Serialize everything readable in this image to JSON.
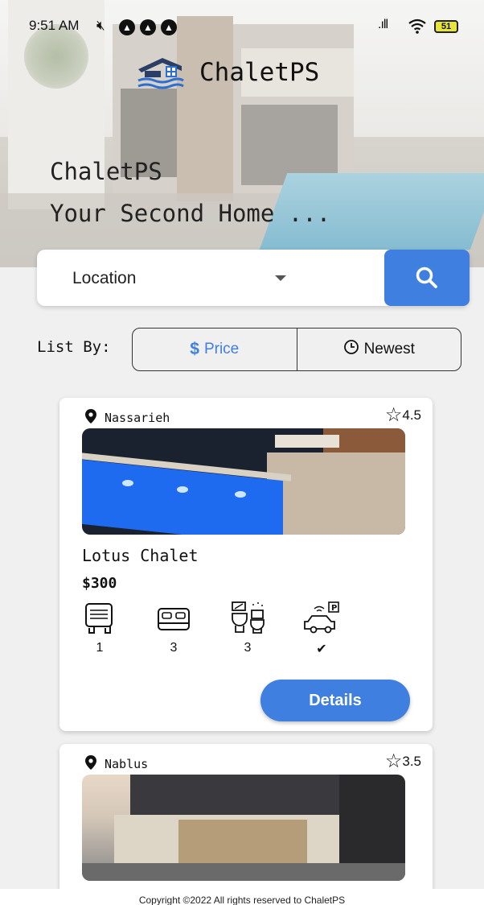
{
  "status_bar": {
    "time": "9:51 AM",
    "battery": "51"
  },
  "header": {
    "app_name": "ChaletPS",
    "tagline_line1": "ChaletPS",
    "tagline_line2": "Your Second Home ..."
  },
  "search": {
    "location_value": "Location"
  },
  "sort": {
    "label": "List By:",
    "options": [
      "Price",
      "Newest"
    ],
    "selected": "Price"
  },
  "listings": [
    {
      "location": "Nassarieh",
      "rating": "4.5",
      "name": "Lotus Chalet",
      "price": "$300",
      "pools": "1",
      "bedrooms": "3",
      "bathrooms": "3",
      "parking": "✔",
      "details_label": "Details"
    },
    {
      "location": "Nablus",
      "rating": "3.5"
    }
  ],
  "footer": {
    "copyright": "Copyright ©2022 All rights reserved to ChaletPS"
  },
  "colors": {
    "accent": "#3f7fe0",
    "background": "#f0f0f0"
  }
}
